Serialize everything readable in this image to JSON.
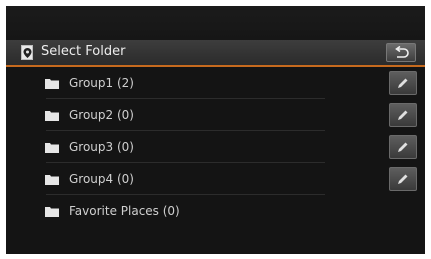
{
  "header": {
    "title": "Select Folder",
    "icon": "folder-select-icon",
    "back_icon": "back-arrow-icon",
    "accent_color": "#c66a1e"
  },
  "folders": [
    {
      "label": "Group1 (2)",
      "editable": true
    },
    {
      "label": "Group2 (0)",
      "editable": true
    },
    {
      "label": "Group3 (0)",
      "editable": true
    },
    {
      "label": "Group4 (0)",
      "editable": true
    },
    {
      "label": "Favorite Places (0)",
      "editable": false
    }
  ]
}
